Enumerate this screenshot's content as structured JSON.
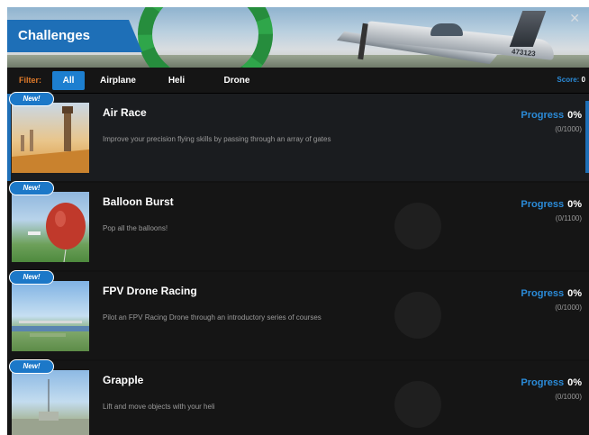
{
  "window": {
    "title": "Challenges",
    "close_glyph": "✕"
  },
  "filter": {
    "label": "Filter:",
    "tabs": [
      "All",
      "Airplane",
      "Heli",
      "Drone"
    ],
    "active": "All"
  },
  "score": {
    "label": "Score:",
    "value": "0"
  },
  "challenges": [
    {
      "badge": "New!",
      "title": "Air Race",
      "description": "Improve your precision flying skills by passing through an array of gates",
      "progress_label": "Progress",
      "progress_pct": "0%",
      "progress_count": "(0/1000)"
    },
    {
      "badge": "New!",
      "title": "Balloon Burst",
      "description": "Pop all the balloons!",
      "progress_label": "Progress",
      "progress_pct": "0%",
      "progress_count": "(0/1100)"
    },
    {
      "badge": "New!",
      "title": "FPV Drone Racing",
      "description": "Pilot an FPV Racing Drone through an introductory series of courses",
      "progress_label": "Progress",
      "progress_pct": "0%",
      "progress_count": "(0/1000)"
    },
    {
      "badge": "New!",
      "title": "Grapple",
      "description": "Lift and move objects with your heli",
      "progress_label": "Progress",
      "progress_pct": "0%",
      "progress_count": "(0/1000)"
    }
  ],
  "banner": {
    "tail_number": "473123"
  },
  "colors": {
    "accent": "#1e6fb7",
    "filter_label": "#e07a2a",
    "progress_label": "#2b8bd8"
  }
}
